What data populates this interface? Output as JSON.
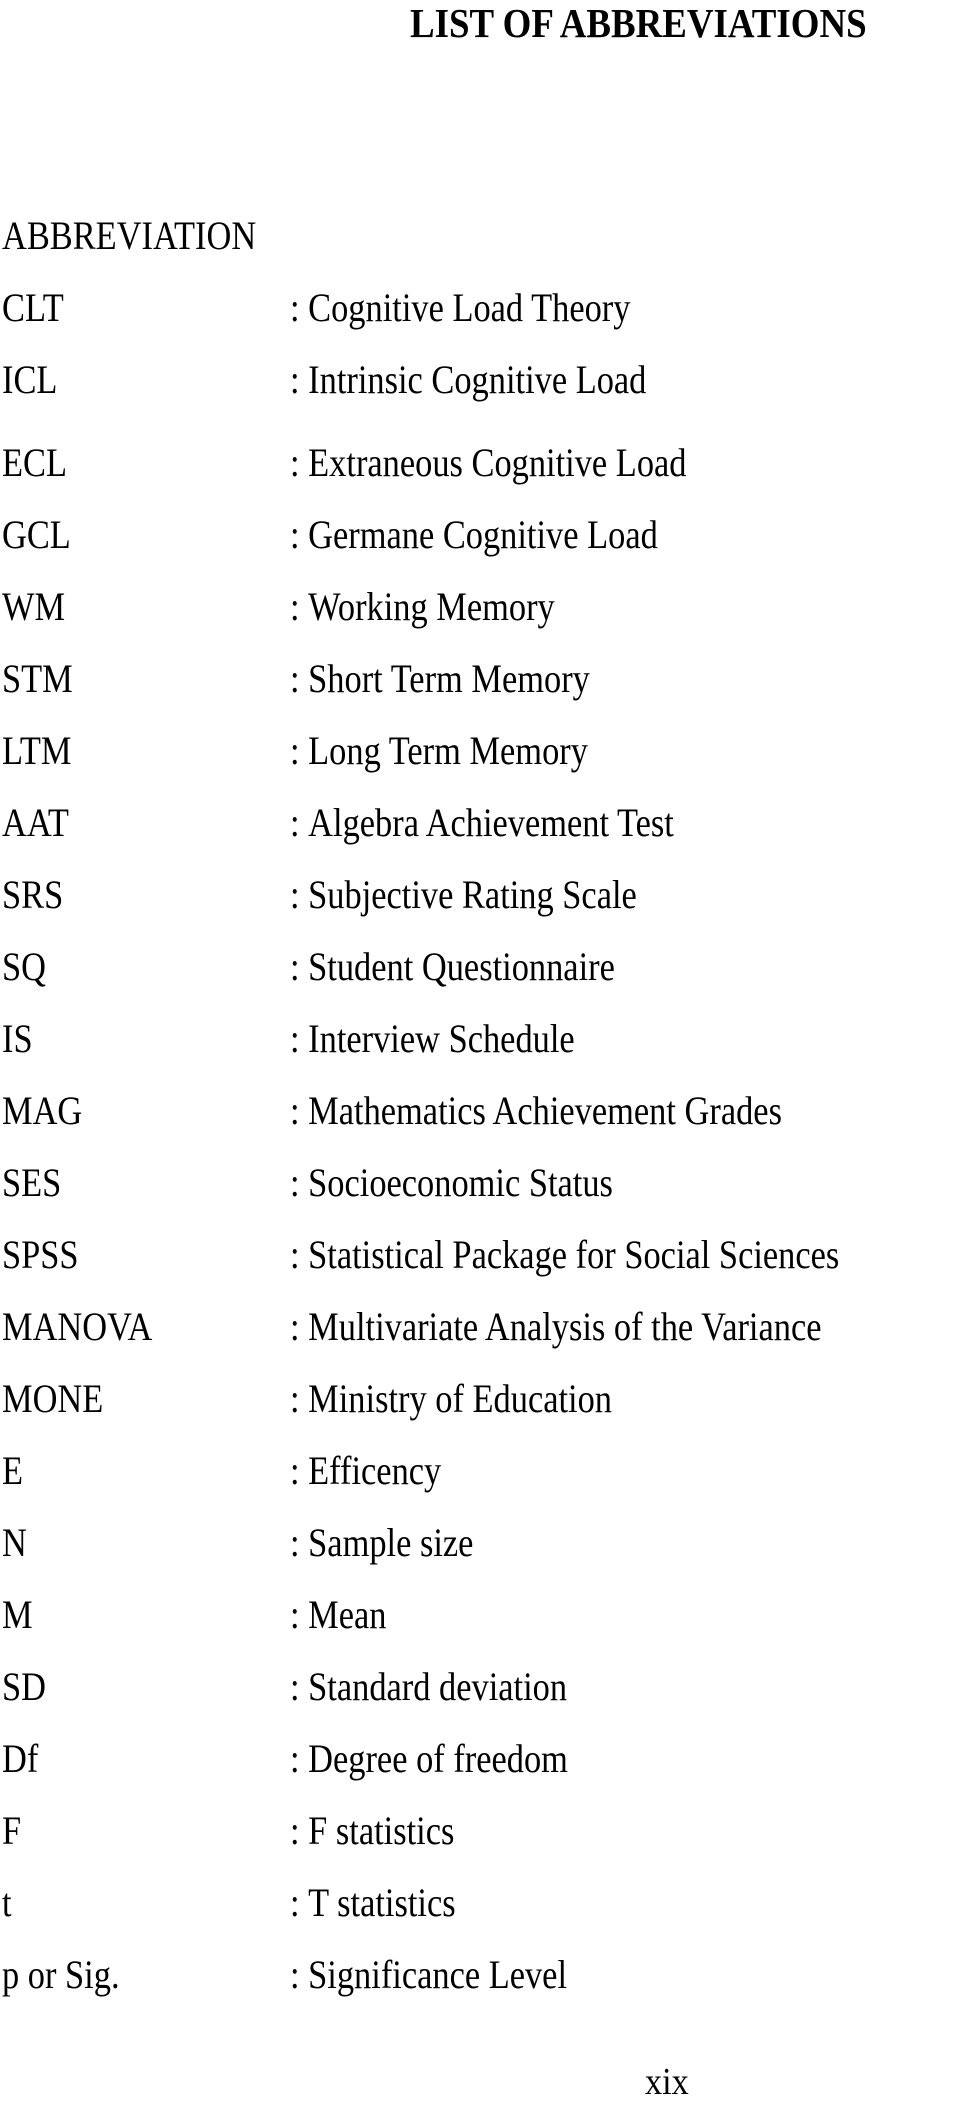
{
  "document": {
    "title": "LIST OF ABBREVIATIONS",
    "column_header": "ABBREVIATION",
    "separator": ":",
    "page_number": "xix"
  },
  "abbreviations": [
    {
      "term": "CLT",
      "definition": "Cognitive Load Theory"
    },
    {
      "term": "ICL",
      "definition": "Intrinsic Cognitive Load"
    },
    {
      "term": "ECL",
      "definition": "Extraneous Cognitive Load"
    },
    {
      "term": "GCL",
      "definition": "Germane Cognitive Load"
    },
    {
      "term": "WM",
      "definition": "Working Memory"
    },
    {
      "term": "STM",
      "definition": "Short Term Memory"
    },
    {
      "term": "LTM",
      "definition": "Long Term Memory"
    },
    {
      "term": "AAT",
      "definition": "Algebra Achievement Test"
    },
    {
      "term": "SRS",
      "definition": "Subjective Rating Scale"
    },
    {
      "term": "SQ",
      "definition": "Student Questionnaire"
    },
    {
      "term": "IS",
      "definition": "Interview Schedule"
    },
    {
      "term": "MAG",
      "definition": "Mathematics Achievement Grades"
    },
    {
      "term": "SES",
      "definition": "Socioeconomic Status"
    },
    {
      "term": "SPSS",
      "definition": "Statistical Package for Social Sciences"
    },
    {
      "term": "MANOVA",
      "definition": "Multivariate Analysis of the Variance"
    },
    {
      "term": "MONE",
      "definition": "Ministry of Education"
    },
    {
      "term": "E",
      "definition": "Efficency"
    },
    {
      "term": "N",
      "definition": "Sample size"
    },
    {
      "term": "M",
      "definition": "Mean"
    },
    {
      "term": "SD",
      "definition": "Standard deviation"
    },
    {
      "term": "Df",
      "definition": "Degree of freedom"
    },
    {
      "term": "F",
      "definition": "F statistics"
    },
    {
      "term": "t",
      "definition": "T statistics"
    },
    {
      "term": "p or Sig.",
      "definition": "Significance Level"
    }
  ]
}
